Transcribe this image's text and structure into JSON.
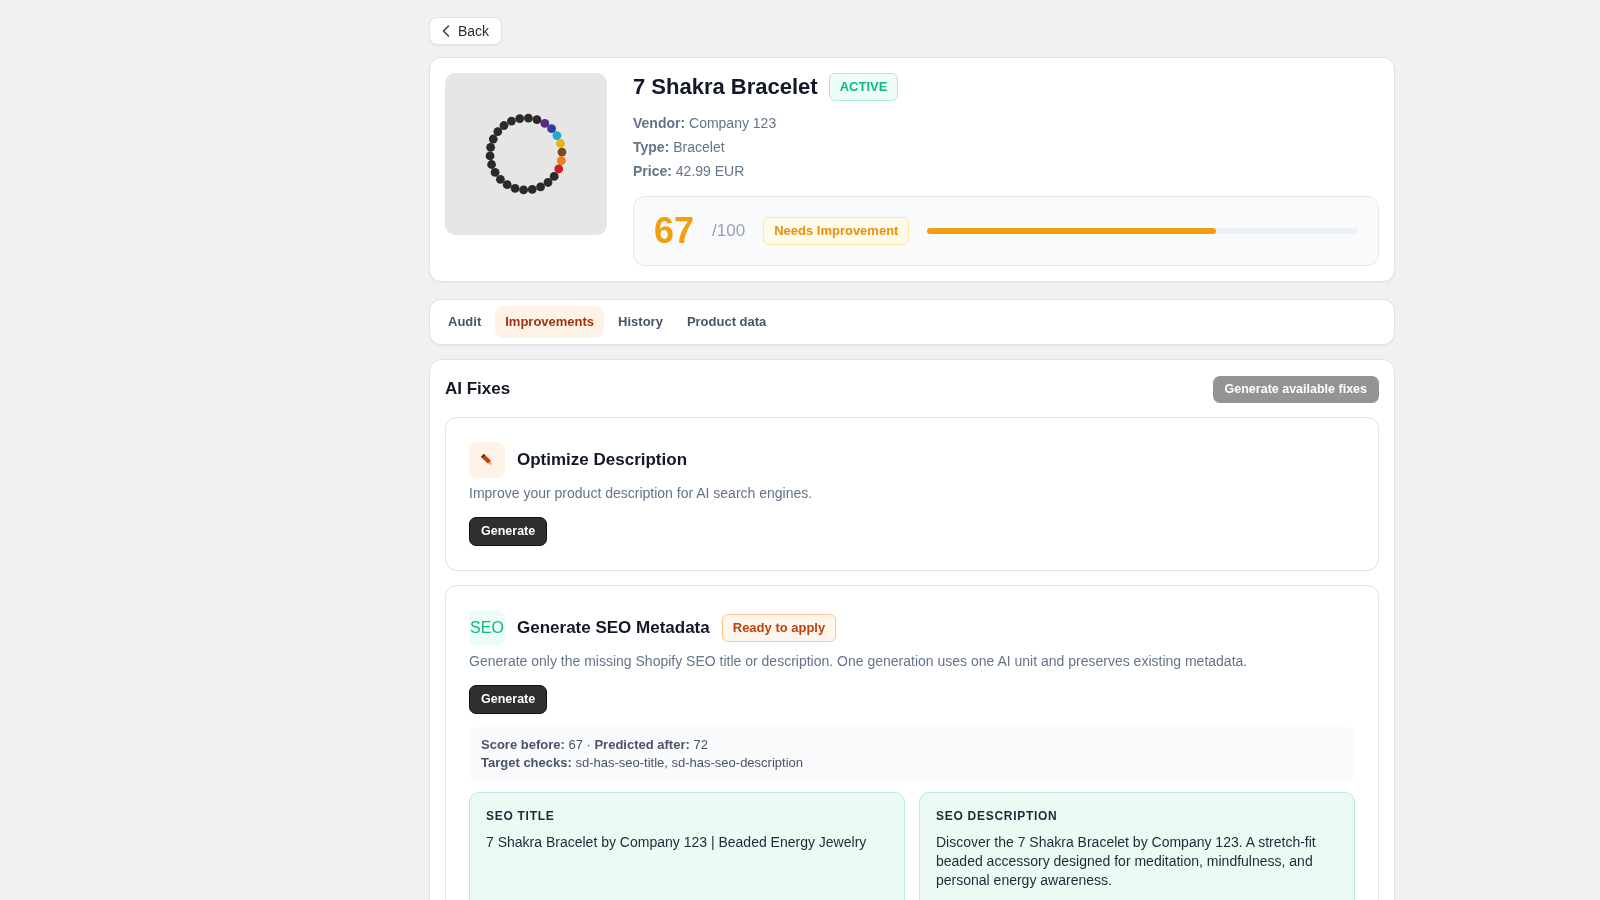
{
  "back_button": {
    "label": "Back"
  },
  "product": {
    "title": "7 Shakra Bracelet",
    "status": {
      "label": "ACTIVE",
      "kind": "active"
    },
    "details": [
      "**Vendor:** Company 123",
      "**Type:** Bracelet",
      "**Price:** 42.99 EUR"
    ],
    "score": {
      "value": "67",
      "max": "/100",
      "rating": {
        "label": "Needs Improvement",
        "kind": "needs_improvement"
      },
      "level": 0.67
    }
  },
  "tabs": [
    {
      "label": "Audit",
      "selected": false
    },
    {
      "label": "Improvements",
      "selected": true
    },
    {
      "label": "History",
      "selected": false
    },
    {
      "label": "Product data",
      "selected": false
    }
  ],
  "ai_fixes": {
    "title": "AI Fixes",
    "generate_all_button": {
      "label": "Generate available fixes",
      "disabled": true
    },
    "fixes": [
      {
        "icon": {
          "kind": "pencil"
        },
        "title": "Optimize Description",
        "description": "Improve your product description for AI search engines.",
        "button": "Generate"
      },
      {
        "icon": {
          "kind": "text",
          "text": "SEO"
        },
        "title": "Generate SEO Metadata",
        "status": {
          "label": "Ready to apply",
          "kind": "ready"
        },
        "description": "Generate only the missing Shopify SEO title or description. One generation uses one AI unit and preserves existing metadata.",
        "button": "Generate",
        "summary": [
          "**Score before:** 67 · **Predicted after:** 72",
          "**Target checks:** sd-has-seo-title, sd-has-seo-description"
        ],
        "outputs": [
          {
            "label": "SEO TITLE",
            "text": "7 Shakra Bracelet by Company 123 | Beaded Energy Jewelry"
          },
          {
            "label": "SEO DESCRIPTION",
            "text": "Discover the 7 Shakra Bracelet by Company 123. A stretch-fit beaded accessory designed for meditation, mindfulness, and personal energy awareness."
          }
        ]
      }
    ]
  }
}
